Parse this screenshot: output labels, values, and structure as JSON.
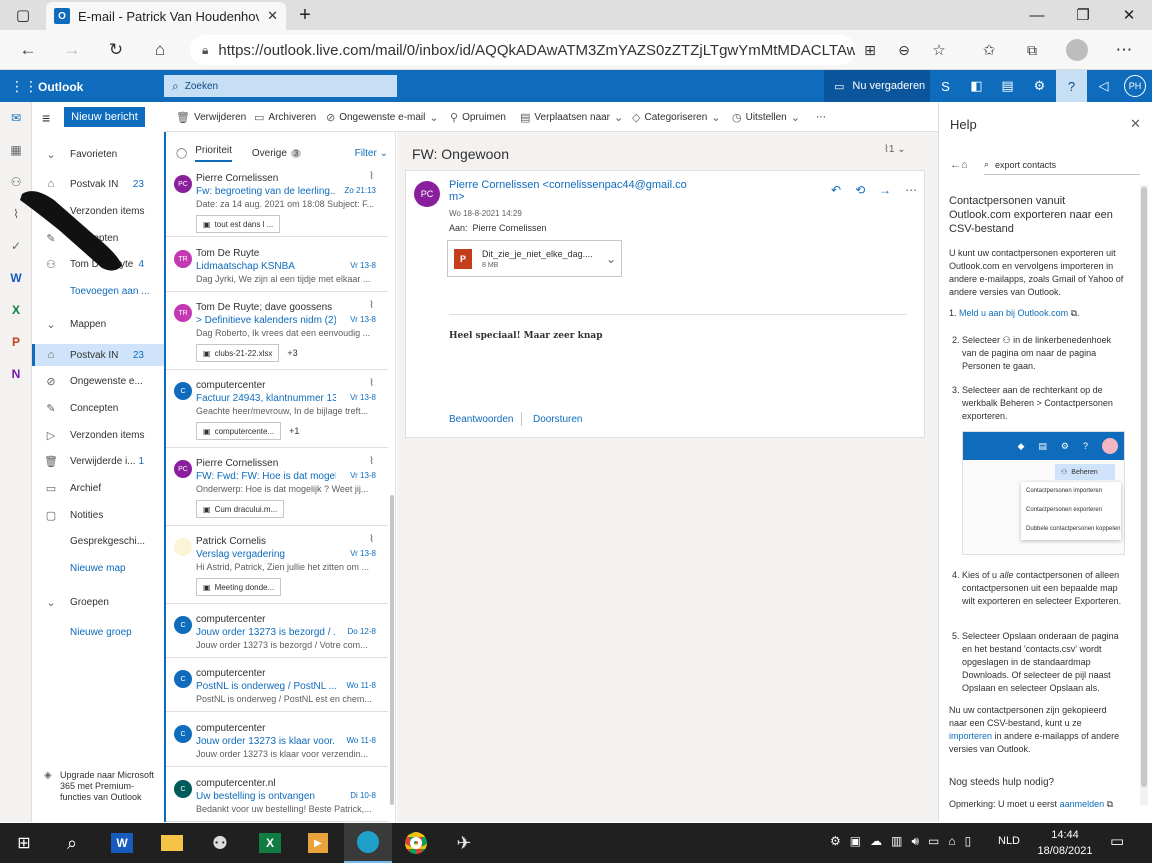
{
  "browser": {
    "tab_title": "E-mail - Patrick Van Houdenhove",
    "url": "https://outlook.live.com/mail/0/inbox/id/AQQkADAwATM3ZmYAZS0zZTZjLTgwYmMtMDACLTAwC..."
  },
  "outlook": {
    "app_name": "Outlook",
    "search_placeholder": "Zoeken",
    "meet_label": "Nu vergaderen",
    "avatar_initials": "PH"
  },
  "folders": {
    "new_message": "Nieuw bericht",
    "favorites_label": "Favorieten",
    "favorites": [
      {
        "label": "Postvak IN",
        "count": "23"
      },
      {
        "label": "Verzonden items",
        "count": ""
      },
      {
        "label": "Concepten",
        "count": ""
      },
      {
        "label": "Tom De Ruyte",
        "count": "4"
      },
      {
        "label": "Toevoegen aan ...",
        "count": ""
      }
    ],
    "mappen_label": "Mappen",
    "mappen": [
      {
        "label": "Postvak IN",
        "count": "23"
      },
      {
        "label": "Ongewenste e...",
        "count": ""
      },
      {
        "label": "Concepten",
        "count": ""
      },
      {
        "label": "Verzonden items",
        "count": ""
      },
      {
        "label": "Verwijderde i...",
        "count": "1"
      },
      {
        "label": "Archief",
        "count": ""
      },
      {
        "label": "Notities",
        "count": ""
      },
      {
        "label": "Gesprekgeschi...",
        "count": ""
      },
      {
        "label": "Nieuwe map",
        "count": ""
      }
    ],
    "groepen_label": "Groepen",
    "new_group": "Nieuwe groep",
    "upgrade": "Upgrade naar Microsoft 365 met Premium-functies van Outlook"
  },
  "commands": [
    "Verwijderen",
    "Archiveren",
    "Ongewenste e-mail",
    "Opruimen",
    "Verplaatsen naar",
    "Categoriseren",
    "Uitstellen"
  ],
  "list": {
    "tab_focused": "Prioriteit",
    "tab_other": "Overige",
    "other_count": "3",
    "filter": "Filter",
    "messages": [
      {
        "initials": "PC",
        "color": "#8a1f9e",
        "sender": "Pierre Cornelissen",
        "subject": "Fw: begroeting van de leerling...",
        "date": "Zo 21:13",
        "preview": "Date: za 14 aug. 2021 om 18:08 Subject: F...",
        "attachment": "tout est dans l ...",
        "more": "",
        "clip": true
      },
      {
        "initials": "TR",
        "color": "#c239b3",
        "sender": "Tom De Ruyte",
        "subject": "Lidmaatschap KSNBA",
        "date": "Vr 13-8",
        "preview": "Dag Jyrki, We zijn al een tijdje met elkaar ...",
        "attachment": "",
        "more": "",
        "clip": false
      },
      {
        "initials": "TR",
        "color": "#c239b3",
        "sender": "Tom De Ruyte; dave goossens",
        "subject": "> Definitieve kalenders nidm (2)",
        "date": "Vr 13-8",
        "preview": "Dag Roberto, Ik vrees dat een eenvoudig ...",
        "attachment": "clubs-21-22.xlsx",
        "more": "+3",
        "clip": true
      },
      {
        "initials": "C",
        "color": "#0f6cbd",
        "sender": "computercenter",
        "subject": "Factuur 24943, klantnummer 13...",
        "date": "Vr 13-8",
        "preview": "Geachte heer/mevrouw, In de bijlage treft...",
        "attachment": "computercente...",
        "more": "+1",
        "clip": true
      },
      {
        "initials": "PC",
        "color": "#8a1f9e",
        "sender": "Pierre Cornelissen",
        "subject": "FW: Fwd: FW: Hoe is dat mogeli...",
        "date": "Vr 13-8",
        "preview": "Onderwerp: Hoe is dat mogelijk ? Weet jij...",
        "attachment": "Cum dracului.m...",
        "more": "",
        "clip": true
      },
      {
        "initials": "",
        "color": "#fbf4d6",
        "sender": "Patrick Cornelis",
        "subject": "Verslag vergadering",
        "date": "Vr 13-8",
        "preview": "Hi Astrid, Patrick, Zien jullie het zitten om ...",
        "attachment": "Meeting donde...",
        "more": "",
        "clip": true
      },
      {
        "initials": "C",
        "color": "#0f6cbd",
        "sender": "computercenter",
        "subject": "Jouw order 13273 is bezorgd / ...",
        "date": "Do 12-8",
        "preview": "Jouw order 13273 is bezorgd / Votre com...",
        "attachment": "",
        "more": "",
        "clip": false
      },
      {
        "initials": "C",
        "color": "#0f6cbd",
        "sender": "computercenter",
        "subject": "PostNL is onderweg / PostNL ...",
        "date": "Wo 11-8",
        "preview": "PostNL is onderweg / PostNL est en chem...",
        "attachment": "",
        "more": "",
        "clip": false
      },
      {
        "initials": "C",
        "color": "#0f6cbd",
        "sender": "computercenter",
        "subject": "Jouw order 13273 is klaar voor...",
        "date": "Wo 11-8",
        "preview": "Jouw order 13273 is klaar voor verzendin...",
        "attachment": "",
        "more": "",
        "clip": false
      },
      {
        "initials": "C",
        "color": "#005a5a",
        "sender": "computercenter.nl",
        "subject": "Uw bestelling is ontvangen",
        "date": "Di 10-8",
        "preview": "Bedankt voor uw bestelling! Beste Patrick,...",
        "attachment": "",
        "more": "",
        "clip": false
      }
    ]
  },
  "reading": {
    "title": "FW: Ongewoon",
    "attach_count": "1",
    "avatar": "PC",
    "from_line1": "Pierre Cornelissen <cornelissenpac44@gmail.co",
    "from_line2": "m>",
    "date": "Wo 18-8-2021 14:29",
    "to_label": "Aan:",
    "to": "Pierre Cornelissen",
    "file_name": "Dit_zie_je_niet_elke_dag....",
    "file_size": "8 MB",
    "body": "Heel speciaal! Maar zeer knap",
    "reply": "Beantwoorden",
    "forward": "Doorsturen"
  },
  "help": {
    "title": "Help",
    "search": "export contacts",
    "heading": "Contactpersonen vanuit Outlook.com exporteren naar een CSV-bestand",
    "intro": "U kunt uw contactpersonen exporteren uit Outlook.com en vervolgens importeren in andere e-mailapps, zoals Gmail of Yahoo of andere versies van Outlook.",
    "step1": "Meld u aan bij Outlook.com",
    "step2a": "Selecteer",
    "step2b": "in de linkerbenedenhoek van de pagina om naar de pagina Personen te gaan.",
    "step3": "Selecteer aan de rechterkant op de werkbalk Beheren > Contactpersonen exporteren.",
    "img_manage": "Beheren",
    "img_menu": [
      "Contactpersonen importeren",
      "Contactpersonen exporteren",
      "Dubbele contactpersonen koppelen"
    ],
    "step4a": "Kies of u",
    "step4b": "alle",
    "step4c": "contactpersonen of alleen contactpersonen uit een bepaalde map wilt exporteren en selecteer Exporteren.",
    "step5": "Selecteer Opslaan onderaan de pagina en het bestand 'contacts.csv' wordt opgeslagen in de standaardmap Downloads. Of selecteer de pijl naast Opslaan en selecteer Opslaan als.",
    "outro_a": "Nu uw contactpersonen zijn gekopieerd naar een CSV-bestand, kunt u ze",
    "outro_link": "importeren",
    "outro_b": "in andere e-mailapps of andere versies van Outlook.",
    "more_help": "Nog steeds hulp nodig?",
    "note_a": "Opmerking: U moet u eerst",
    "note_link": "aanmelden"
  },
  "taskbar": {
    "lang": "NLD",
    "time": "14:44",
    "date": "18/08/2021"
  }
}
